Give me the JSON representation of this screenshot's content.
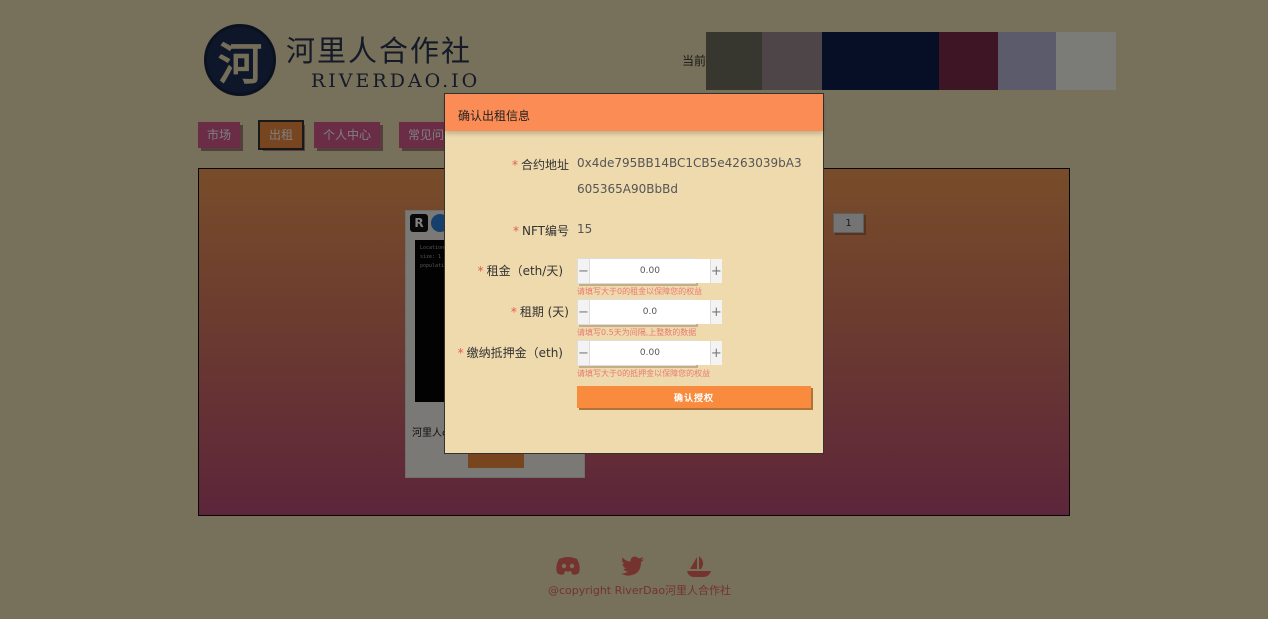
{
  "header": {
    "logo_char": "河",
    "logo_name": "河里人合作社",
    "logo_sub": "RIVERDAO.IO",
    "theme_label": "当前係",
    "swatches": [
      "#6f6e5f",
      "#9b8a8e",
      "#0d1f4d",
      "#7d2b48",
      "#b7b7d8",
      "#f7f6f1"
    ]
  },
  "nav": {
    "items": [
      {
        "label": "市场"
      },
      {
        "label": "出租"
      },
      {
        "label": "个人中心"
      },
      {
        "label": "常见问"
      }
    ]
  },
  "card": {
    "title": "河里人c",
    "screen_lines": [
      "Location:",
      "size: 1",
      "populati"
    ]
  },
  "pager": {
    "current": "1"
  },
  "footer": {
    "copyright": "@copyright RiverDao河里人合作社"
  },
  "modal": {
    "title": "确认出租信息",
    "contract_label": "合约地址",
    "contract_value": "0x4de795BB14BC1CB5e4263039bA3605365A90BbBd",
    "nft_label": "NFT编号",
    "nft_value": "15",
    "rent_label": "租金（eth/天)",
    "rent_value": "0.00",
    "rent_hint": "请填写大于0的租金以保障您的权益",
    "period_label": "租期 (天)",
    "period_value": "0.0",
    "period_hint": "请填写0.5天为间隔,上整数的数据",
    "deposit_label": "缴纳抵押金（eth)",
    "deposit_value": "0.00",
    "deposit_hint": "请填写大于0的抵押金以保障您的权益",
    "minus": "−",
    "plus": "+",
    "required_mark": "*",
    "confirm_label": "确认授权"
  }
}
